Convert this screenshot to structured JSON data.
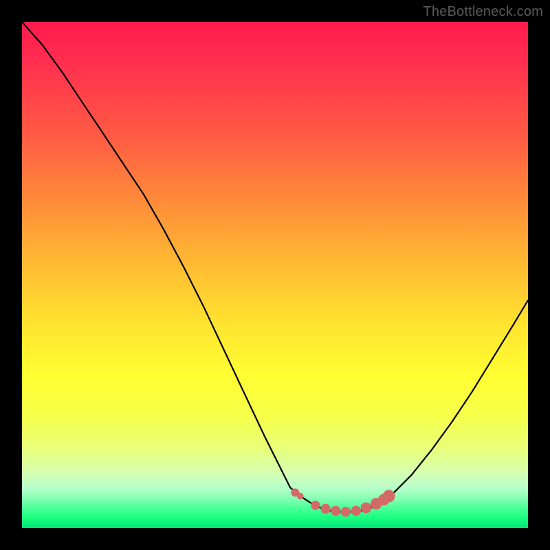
{
  "watermark": "TheBottleneck.com",
  "colors": {
    "page_bg": "#000000",
    "gradient_top": "#ff1a4d",
    "gradient_bottom": "#00e676",
    "curve": "#000000",
    "markers": "#d36a66"
  },
  "chart_data": {
    "type": "line",
    "title": "",
    "xlabel": "",
    "ylabel": "",
    "xlim": [
      0,
      100
    ],
    "ylim": [
      0,
      100
    ],
    "x": [
      0,
      4,
      8,
      12,
      16,
      20,
      24,
      28,
      32,
      36,
      40,
      44,
      48,
      52,
      53,
      55,
      57,
      59,
      61,
      63,
      65,
      67,
      69,
      71,
      73,
      77,
      81,
      85,
      89,
      93,
      97,
      100
    ],
    "values": [
      100,
      95.5,
      90,
      84,
      78,
      72,
      66,
      59,
      51.5,
      43.5,
      35,
      26.5,
      18,
      10,
      8,
      6.3,
      5,
      4,
      3.4,
      3.2,
      3.2,
      3.4,
      4,
      5,
      6.5,
      10.5,
      15.5,
      21,
      27,
      33.5,
      40,
      45
    ],
    "markers": [
      {
        "x": 54,
        "y": 7,
        "r": 1.0
      },
      {
        "x": 55,
        "y": 6.3,
        "r": 0.8
      },
      {
        "x": 58,
        "y": 4.5,
        "r": 1.1
      },
      {
        "x": 60,
        "y": 3.8,
        "r": 1.2
      },
      {
        "x": 62,
        "y": 3.4,
        "r": 1.2
      },
      {
        "x": 64,
        "y": 3.2,
        "r": 1.2
      },
      {
        "x": 66,
        "y": 3.4,
        "r": 1.2
      },
      {
        "x": 68,
        "y": 4.0,
        "r": 1.3
      },
      {
        "x": 70,
        "y": 4.8,
        "r": 1.4
      },
      {
        "x": 71.5,
        "y": 5.6,
        "r": 1.4
      },
      {
        "x": 72.5,
        "y": 6.3,
        "r": 1.5
      }
    ],
    "grid": false,
    "legend": false
  }
}
